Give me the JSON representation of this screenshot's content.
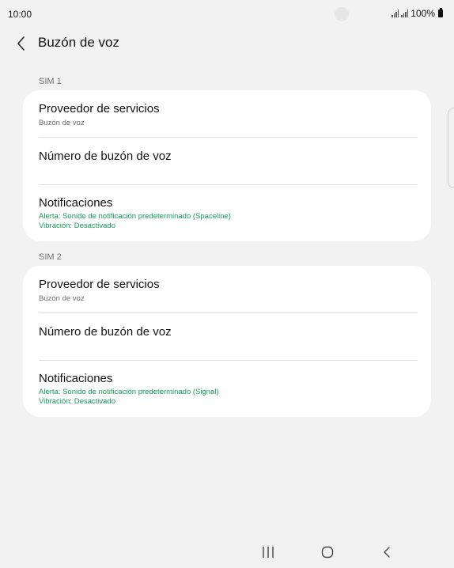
{
  "status_bar": {
    "time": "10:00",
    "battery_text": "100%"
  },
  "header": {
    "title": "Buzón de voz",
    "back_icon": "chevron-left-icon"
  },
  "sections": [
    {
      "label": "SIM 1",
      "items": [
        {
          "title": "Proveedor de servicios",
          "subtitle": "Buzón de voz"
        },
        {
          "title": "Número de buzón de voz"
        },
        {
          "title": "Notificaciones",
          "alert": "Alerta: Sonido de notificación predeterminado (Spaceline)",
          "vibration": "Vibración: Desactivado"
        }
      ]
    },
    {
      "label": "SIM 2",
      "items": [
        {
          "title": "Proveedor de servicios",
          "subtitle": "Buzón de voz"
        },
        {
          "title": "Número de buzón de voz"
        },
        {
          "title": "Notificaciones",
          "alert": "Alerta: Sonido de notificación predeterminado (Signal)",
          "vibration": "Vibración: Desactivado"
        }
      ]
    }
  ],
  "navigation": {
    "recents_icon": "recents-icon",
    "home_icon": "home-icon",
    "back_icon": "back-icon"
  },
  "colors": {
    "background": "#f2f2f2",
    "card": "#ffffff",
    "accent_green": "#0f9d58",
    "secondary_text": "#6e6e6e"
  }
}
